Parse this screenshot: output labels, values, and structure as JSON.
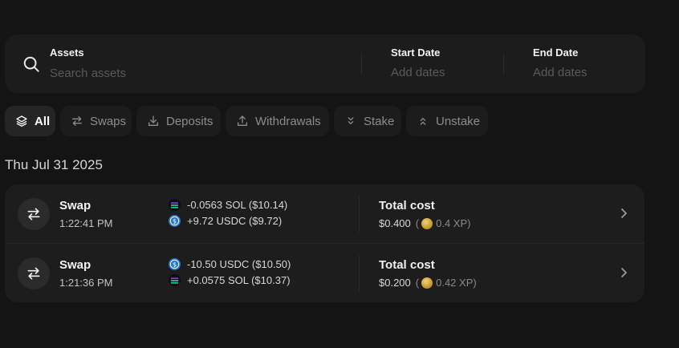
{
  "search": {
    "assets_label": "Assets",
    "assets_placeholder": "Search assets",
    "start_label": "Start Date",
    "start_placeholder": "Add dates",
    "end_label": "End Date",
    "end_placeholder": "Add dates"
  },
  "filters": [
    {
      "label": "All",
      "icon": "layers-icon",
      "active": true
    },
    {
      "label": "Swaps",
      "icon": "swap-arrows-icon",
      "active": false
    },
    {
      "label": "Deposits",
      "icon": "download-icon",
      "active": false
    },
    {
      "label": "Withdrawals",
      "icon": "upload-icon",
      "active": false
    },
    {
      "label": "Stake",
      "icon": "chevrons-down-icon",
      "active": false
    },
    {
      "label": "Unstake",
      "icon": "chevrons-up-icon",
      "active": false
    }
  ],
  "date_heading": "Thu Jul 31 2025",
  "transactions": [
    {
      "type": "Swap",
      "time": "1:22:41 PM",
      "amounts": [
        {
          "token": "sol-icon",
          "text": "-0.0563 SOL ($10.14)"
        },
        {
          "token": "usdc-icon",
          "text": "+9.72 USDC ($9.72)"
        }
      ],
      "cost_label": "Total cost",
      "cost_value": "$0.400",
      "xp": "0.4 XP"
    },
    {
      "type": "Swap",
      "time": "1:21:36 PM",
      "amounts": [
        {
          "token": "usdc-icon",
          "text": "-10.50 USDC ($10.50)"
        },
        {
          "token": "sol-icon",
          "text": "+0.0575 SOL ($10.37)"
        }
      ],
      "cost_label": "Total cost",
      "cost_value": "$0.200",
      "xp": "0.42 XP"
    }
  ],
  "colors": {
    "background": "#141414",
    "panel": "#1c1c1c",
    "usdc": "#2775ca",
    "coin": "#d4a83a"
  }
}
